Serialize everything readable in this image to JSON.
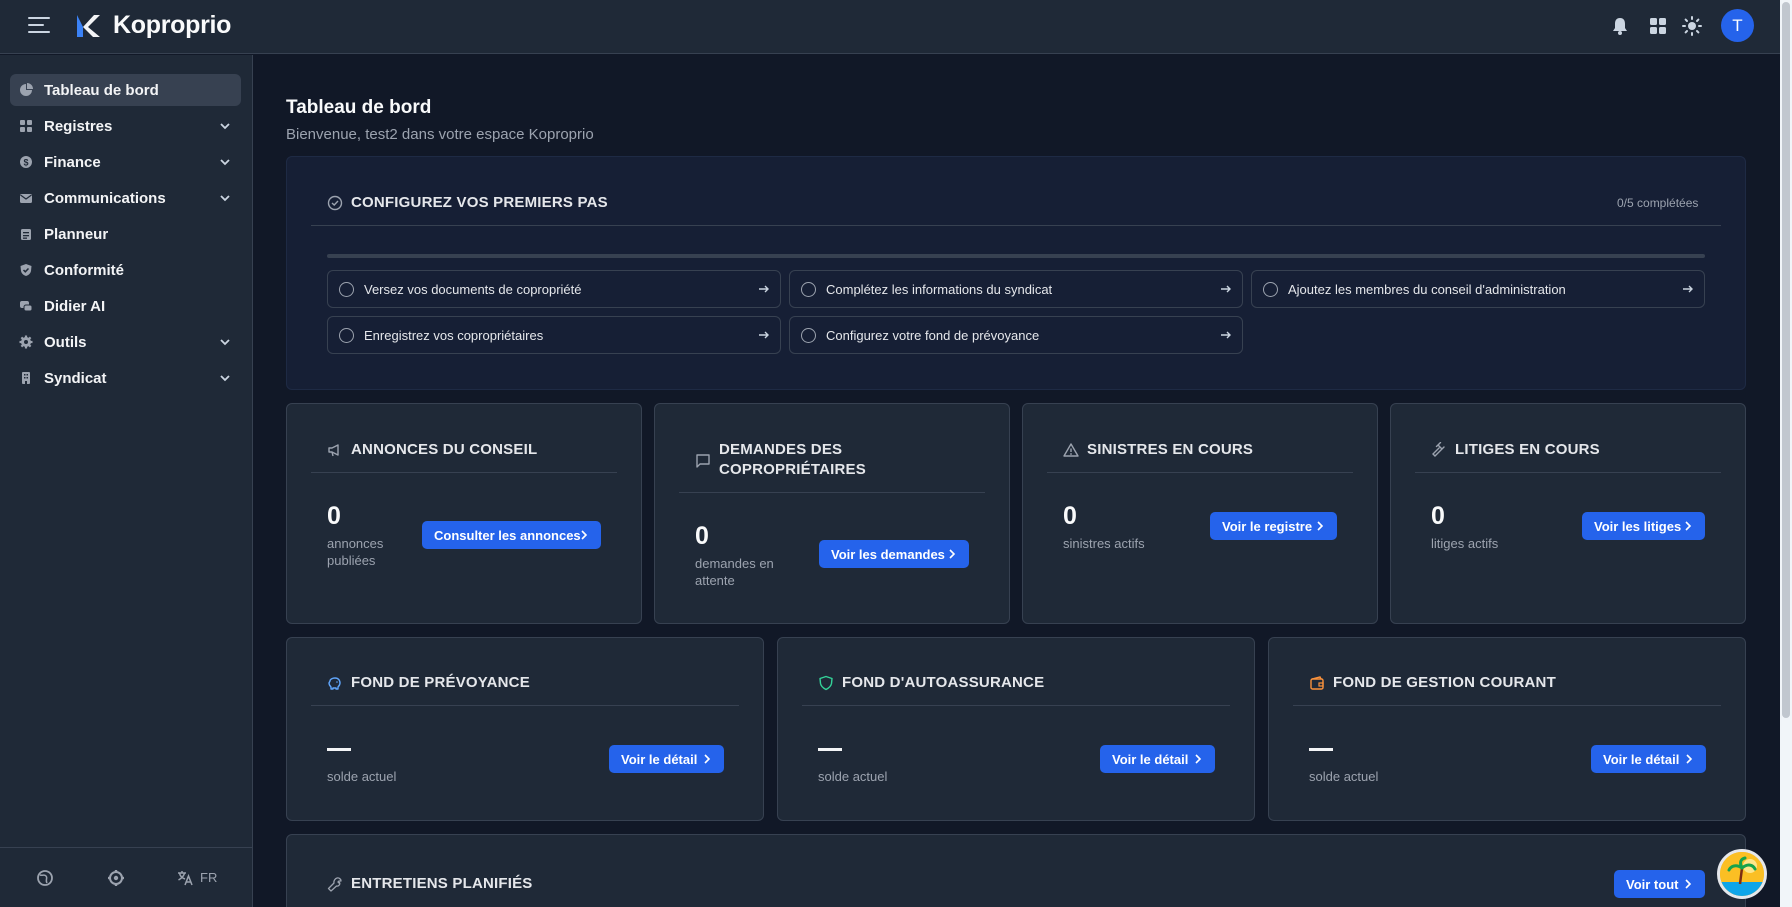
{
  "app": {
    "brand": "Koproprio",
    "avatar_initial": "T",
    "accent_color": "#2563eb"
  },
  "topbar_icons": [
    "menu-icon",
    "bell-icon",
    "apps-grid-icon",
    "sun-icon"
  ],
  "sidebar": {
    "items": [
      {
        "label": "Tableau de bord",
        "icon": "pie-chart-icon",
        "expandable": false,
        "active": true
      },
      {
        "label": "Registres",
        "icon": "grid-icon",
        "expandable": true
      },
      {
        "label": "Finance",
        "icon": "dollar-icon",
        "expandable": true
      },
      {
        "label": "Communications",
        "icon": "mail-icon",
        "expandable": true
      },
      {
        "label": "Planneur",
        "icon": "clipboard-icon",
        "expandable": false
      },
      {
        "label": "Conformité",
        "icon": "shield-check-icon",
        "expandable": false
      },
      {
        "label": "Didier AI",
        "icon": "chat-icon",
        "expandable": false
      },
      {
        "label": "Outils",
        "icon": "cog-icon",
        "expandable": true
      },
      {
        "label": "Syndicat",
        "icon": "building-icon",
        "expandable": true
      }
    ],
    "footer": {
      "language": "FR"
    }
  },
  "page": {
    "title": "Tableau de bord",
    "subtitle": "Bienvenue, test2 dans votre espace Koproprio"
  },
  "setup": {
    "title": "CONFIGUREZ VOS PREMIERS PAS",
    "completed_label": "0/5 complétées",
    "progress": 0,
    "tasks": [
      {
        "label": "Versez vos documents de copropriété"
      },
      {
        "label": "Complétez les informations du syndicat"
      },
      {
        "label": "Ajoutez les membres du conseil d'administration"
      },
      {
        "label": "Enregistrez vos copropriétaires"
      },
      {
        "label": "Configurez votre fond de prévoyance"
      }
    ]
  },
  "stats": [
    {
      "title": "ANNONCES DU CONSEIL",
      "icon": "megaphone-icon",
      "value": "0",
      "label": "annonces publiées",
      "button": "Consulter les annonces"
    },
    {
      "title": "DEMANDES DES COPROPRIÉTAIRES",
      "icon": "message-icon",
      "value": "0",
      "label": "demandes en attente",
      "button": "Voir les demandes"
    },
    {
      "title": "SINISTRES EN COURS",
      "icon": "warning-icon",
      "value": "0",
      "label": "sinistres actifs",
      "button": "Voir le registre"
    },
    {
      "title": "LITIGES EN COURS",
      "icon": "gavel-icon",
      "value": "0",
      "label": "litiges actifs",
      "button": "Voir les litiges"
    }
  ],
  "funds": [
    {
      "title": "FOND DE PRÉVOYANCE",
      "icon": "piggy-bank-icon",
      "icon_color": "#60a5fa",
      "label": "solde actuel",
      "button": "Voir le détail"
    },
    {
      "title": "FOND D'AUTOASSURANCE",
      "icon": "shield-icon",
      "icon_color": "#34d399",
      "label": "solde actuel",
      "button": "Voir le détail"
    },
    {
      "title": "FOND DE GESTION COURANT",
      "icon": "wallet-icon",
      "icon_color": "#fb923c",
      "label": "solde actuel",
      "button": "Voir le détail"
    }
  ],
  "maintenance": {
    "title": "ENTRETIENS PLANIFIÉS",
    "icon": "wrench-icon",
    "button": "Voir tout"
  }
}
